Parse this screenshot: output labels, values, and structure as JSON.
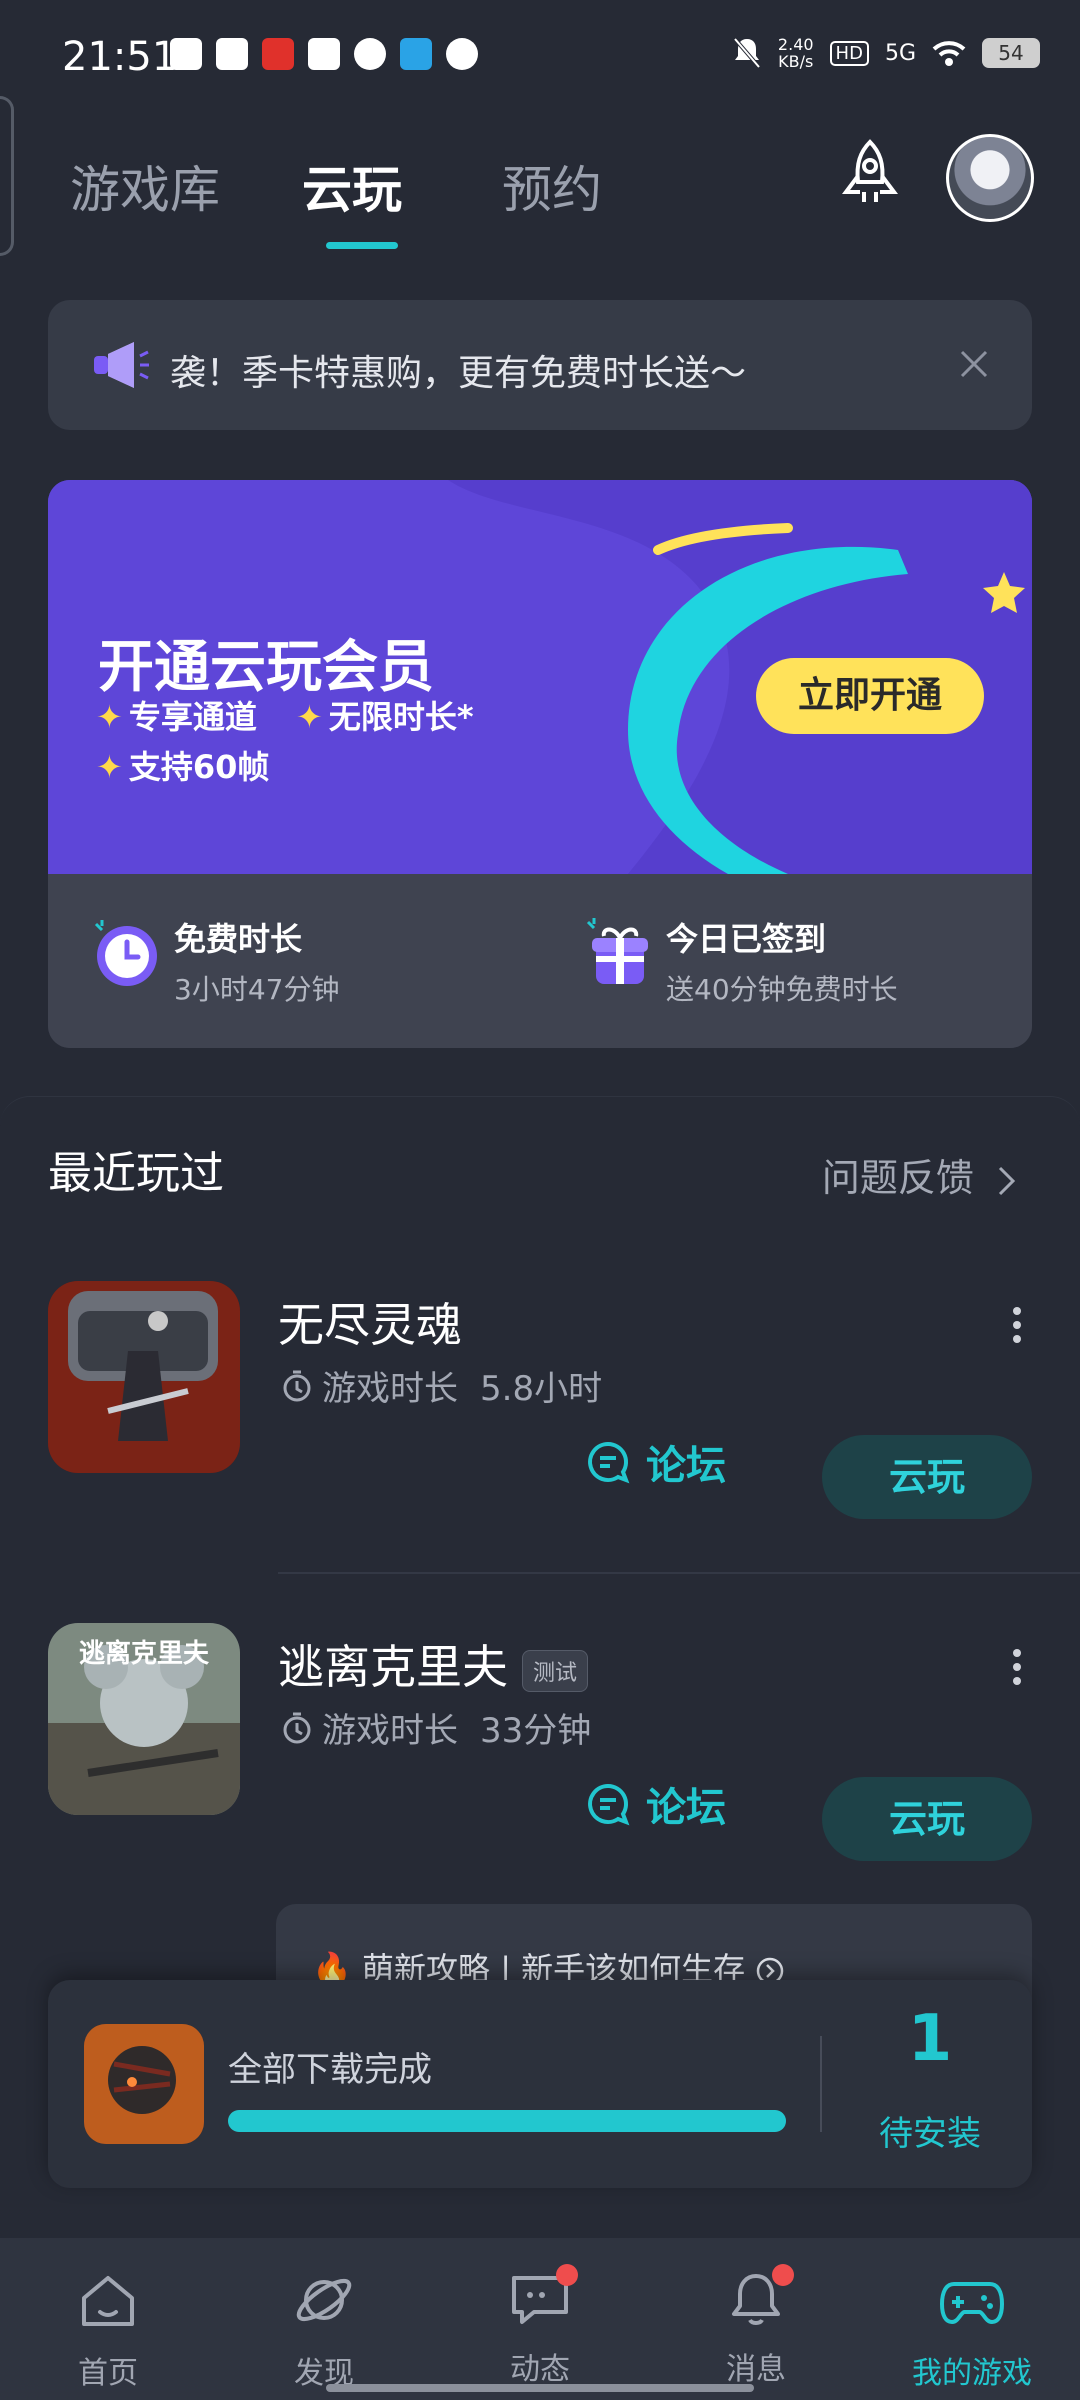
{
  "status": {
    "time": "21:51",
    "net_speed_value": "2.40",
    "net_speed_unit": "KB/s",
    "hd": "HD",
    "signal": "5G",
    "battery": "54"
  },
  "topnav": {
    "tabs": [
      {
        "label": "游戏库"
      },
      {
        "label": "云玩"
      },
      {
        "label": "预约"
      }
    ],
    "active_tab": "云玩"
  },
  "notice": {
    "text": "袭！季卡特惠购，更有免费时长送～"
  },
  "vip": {
    "title": "开通云玩会员",
    "features": [
      "专享通道",
      "无限时长*",
      "支持60帧"
    ],
    "button": "立即开通",
    "free_time_title": "免费时长",
    "free_time_value": "3小时47分钟",
    "signin_title": "今日已签到",
    "signin_sub": "送40分钟免费时长"
  },
  "recent": {
    "title": "最近玩过",
    "feedback": "问题反馈",
    "games": [
      {
        "name": "无尽灵魂",
        "tag": "",
        "time_label": "游戏时长",
        "time_value": "5.8小时",
        "forum": "论坛",
        "play": "云玩"
      },
      {
        "name": "逃离克里夫",
        "tag": "测试",
        "time_label": "游戏时长",
        "time_value": "33分钟",
        "forum": "论坛",
        "play": "云玩",
        "cover_text": "逃离克里夫"
      }
    ],
    "guide": "萌新攻略 | 新手该如何生存"
  },
  "download": {
    "label": "全部下载完成",
    "progress": 1.0,
    "count": "1",
    "pending": "待安装"
  },
  "bottomnav": {
    "items": [
      {
        "label": "首页",
        "icon": "home-icon"
      },
      {
        "label": "发现",
        "icon": "planet-icon"
      },
      {
        "label": "动态",
        "icon": "chat-icon"
      },
      {
        "label": "消息",
        "icon": "bell-icon"
      },
      {
        "label": "我的游戏",
        "icon": "gamepad-icon"
      }
    ],
    "active": "我的游戏"
  },
  "colors": {
    "background": "#262a35",
    "accent": "#22c7cf",
    "vip_purple": "#5e46d8",
    "vip_button": "#ffe25a"
  }
}
